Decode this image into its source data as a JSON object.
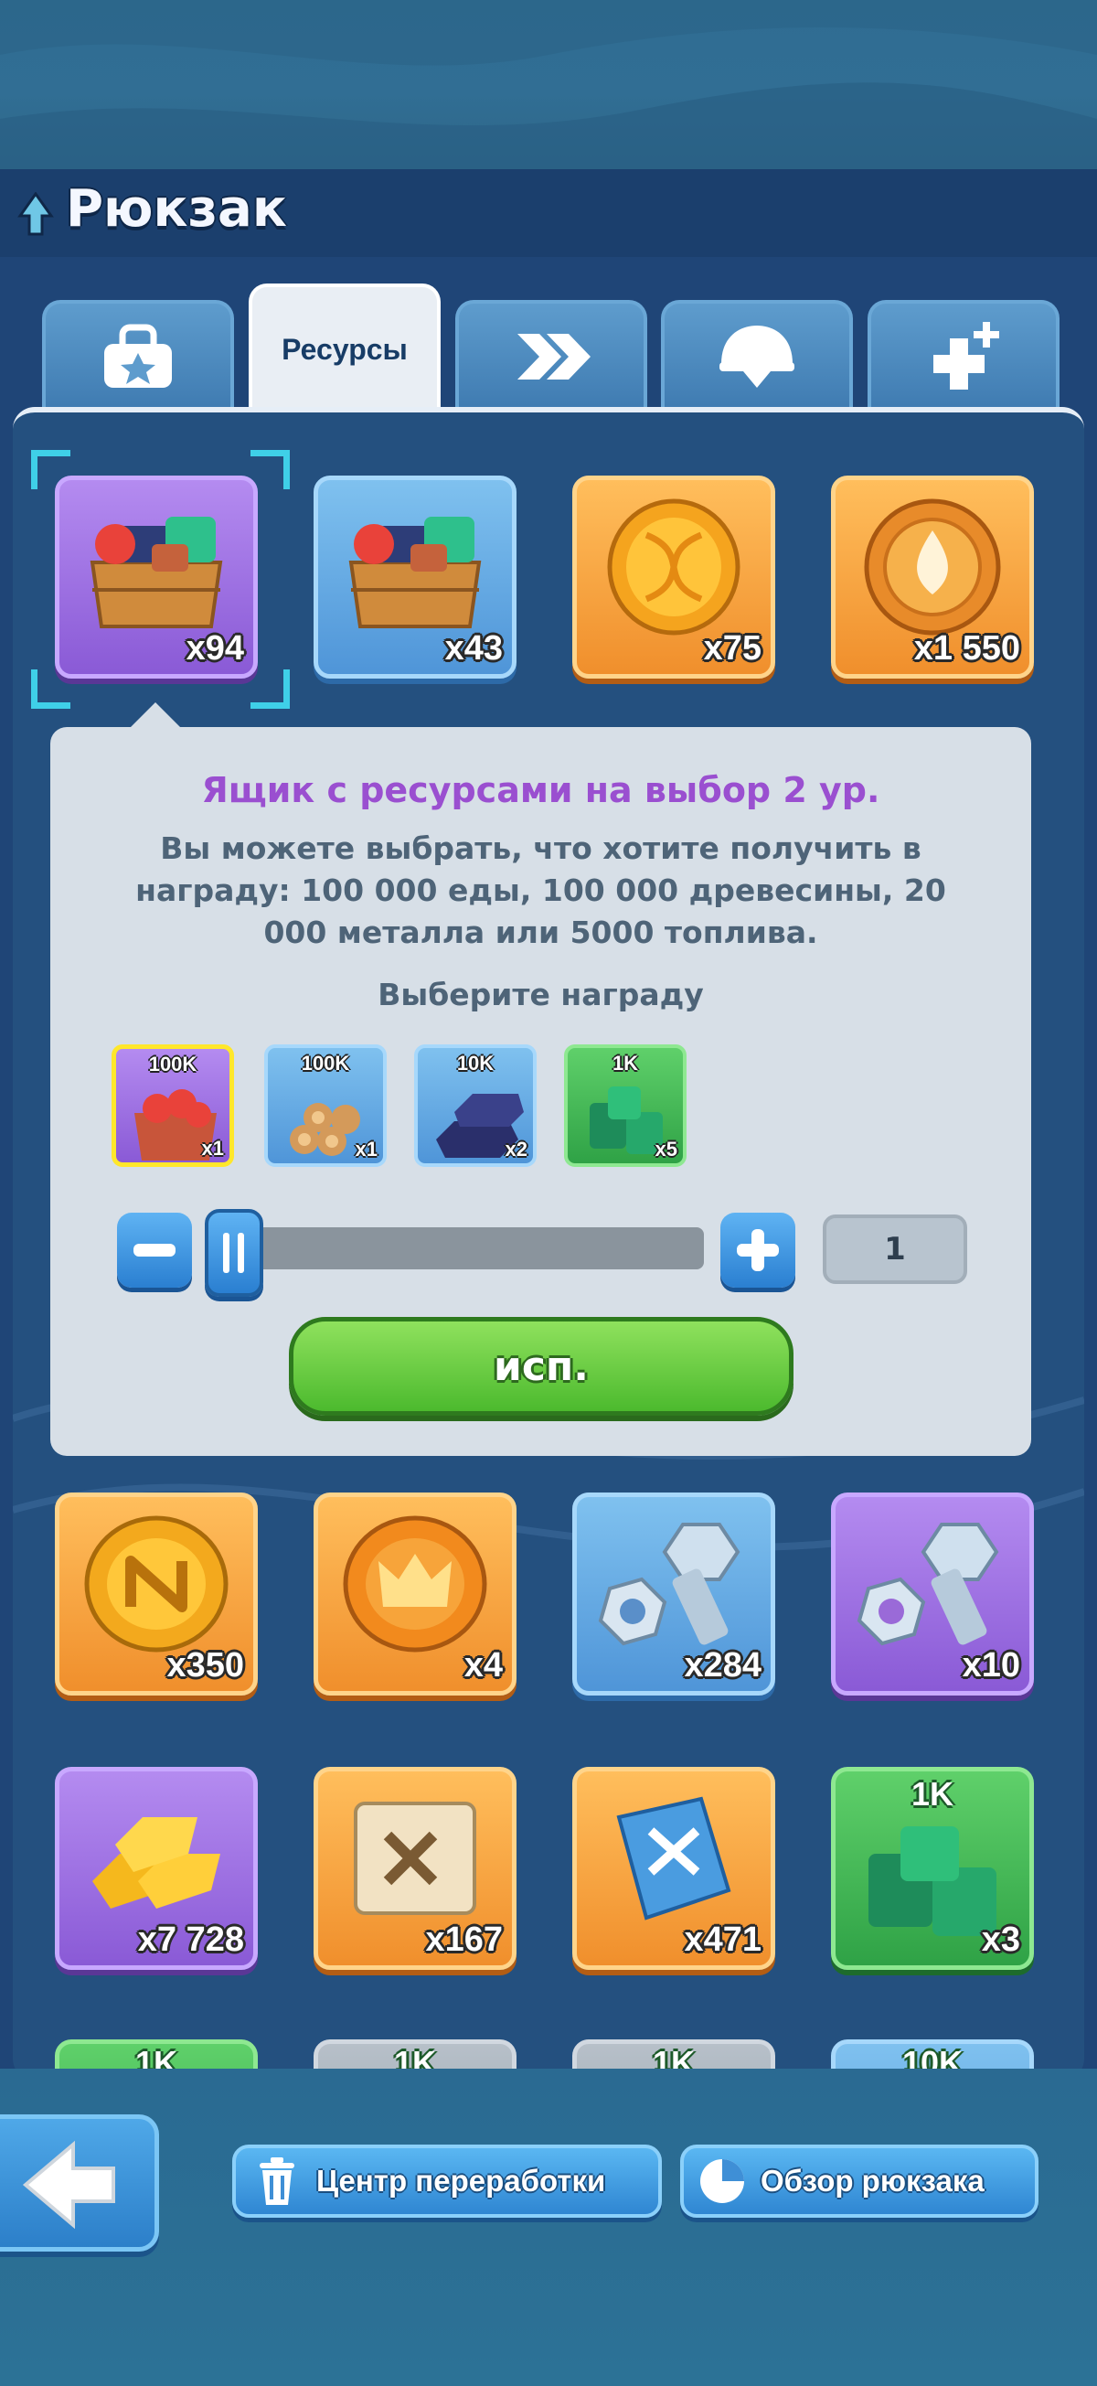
{
  "header": {
    "title": "Рюкзак"
  },
  "tabs": [
    {
      "icon": "backpack-icon",
      "label": ""
    },
    {
      "icon": "",
      "label": "Ресурсы"
    },
    {
      "icon": "speedup-arrows-icon",
      "label": ""
    },
    {
      "icon": "helmet-icon",
      "label": ""
    },
    {
      "icon": "heal-plus-icon",
      "label": ""
    }
  ],
  "items_row1": [
    {
      "icon": "resource-crate-icon",
      "quantity": "x94",
      "rarity": "purple",
      "selected": true
    },
    {
      "icon": "resource-crate-icon",
      "quantity": "x43",
      "rarity": "blue"
    },
    {
      "icon": "dna-coin-icon",
      "quantity": "x75",
      "rarity": "orange"
    },
    {
      "icon": "drop-coin-icon",
      "quantity": "x1 550",
      "rarity": "orange"
    }
  ],
  "popup": {
    "title": "Ящик с ресурсами на выбор 2 ур.",
    "description": "Вы можете выбрать, что хотите получить в награду: 100 000 еды, 100 000 древесины, 20 000 металла или 5000 топлива.",
    "choose_label": "Выберите награду",
    "options": [
      {
        "icon": "food-icon",
        "amount": "100K",
        "count": "x1",
        "selected": true
      },
      {
        "icon": "wood-icon",
        "amount": "100K",
        "count": "x1"
      },
      {
        "icon": "metal-icon",
        "amount": "10K",
        "count": "x2"
      },
      {
        "icon": "fuel-icon",
        "amount": "1K",
        "count": "x5"
      }
    ],
    "quantity_value": "1",
    "use_button": "исп."
  },
  "items_row2": [
    {
      "icon": "n-coin-icon",
      "quantity": "x350",
      "rarity": "orange"
    },
    {
      "icon": "crown-coin-icon",
      "quantity": "x4",
      "rarity": "orange"
    },
    {
      "icon": "bolt-nut-icon",
      "quantity": "x284",
      "rarity": "blue"
    },
    {
      "icon": "bolt-nut-icon",
      "quantity": "x10",
      "rarity": "purple"
    }
  ],
  "items_row3": [
    {
      "icon": "gold-bars-icon",
      "quantity": "x7 728",
      "rarity": "purple"
    },
    {
      "icon": "blueprint-scroll-icon",
      "quantity": "x167",
      "rarity": "orange"
    },
    {
      "icon": "skill-book-icon",
      "quantity": "x471",
      "rarity": "orange"
    },
    {
      "icon": "fuel-icon",
      "quantity": "x3",
      "top_label": "1K",
      "rarity": "green"
    }
  ],
  "items_row4_partial": [
    {
      "top_label": "1K",
      "rarity": "green"
    },
    {
      "top_label": "1K",
      "rarity": "gray"
    },
    {
      "top_label": "1K",
      "rarity": "gray"
    },
    {
      "top_label": "10K",
      "rarity": "blue"
    }
  ],
  "bottom": {
    "back_icon": "back-arrow-icon",
    "recycle_button": "Центр переработки",
    "overview_button": "Обзор рюкзака"
  }
}
